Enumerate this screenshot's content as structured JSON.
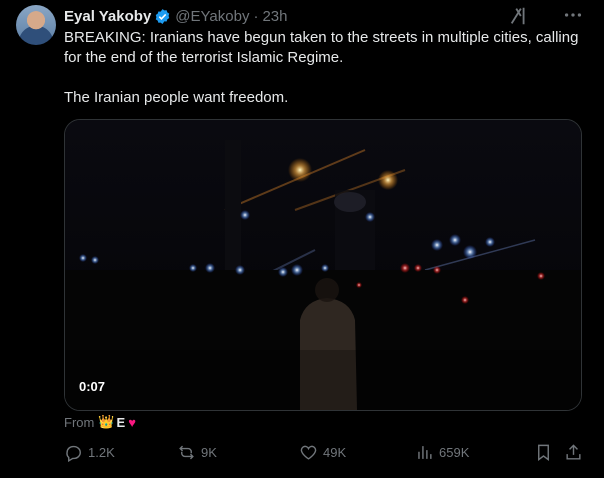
{
  "tweet": {
    "author_name": "Eyal Yakoby",
    "handle": "@EYakoby",
    "separator": "·",
    "time": "23h",
    "paragraphs": [
      "BREAKING: Iranians have begun taken to the streets in multiple cities, calling for the end of the terrorist Islamic Regime.",
      "The Iranian people want freedom."
    ],
    "video_duration": "0:07",
    "from_label": "From",
    "from_crown": "👑",
    "from_name": "E",
    "from_heart": "♥",
    "stats": {
      "replies": "1.2K",
      "reposts": "9K",
      "likes": "49K",
      "views": "659K"
    }
  },
  "icons": {
    "verified": "verified-badge-icon",
    "grok": "grok-icon",
    "more": "more-icon",
    "reply": "reply-icon",
    "repost": "repost-icon",
    "like": "like-icon",
    "views": "views-icon",
    "bookmark": "bookmark-icon",
    "share": "share-icon"
  },
  "colors": {
    "background": "#000000",
    "text": "#e7e9ea",
    "secondary": "#71767b",
    "verified": "#1d9bf0",
    "heart": "#f91880"
  }
}
